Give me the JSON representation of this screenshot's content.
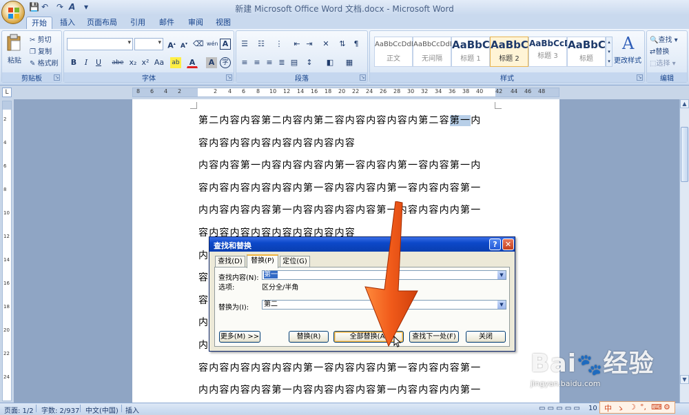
{
  "window": {
    "title": "新建 Microsoft Office Word 文档.docx - Microsoft Word"
  },
  "quick_access": [
    "save-icon",
    "undo-icon",
    "redo-icon",
    "font-color-icon",
    "customize-icon"
  ],
  "tabs": [
    {
      "label": "开始",
      "active": true
    },
    {
      "label": "插入",
      "active": false
    },
    {
      "label": "页面布局",
      "active": false
    },
    {
      "label": "引用",
      "active": false
    },
    {
      "label": "邮件",
      "active": false
    },
    {
      "label": "审阅",
      "active": false
    },
    {
      "label": "视图",
      "active": false
    }
  ],
  "ribbon": {
    "clipboard": {
      "label": "剪贴板",
      "paste": "粘贴",
      "cut": "剪切",
      "copy": "复制",
      "format_painter": "格式刷"
    },
    "font": {
      "label": "字体",
      "font_name": "",
      "font_size": "",
      "bold": "B",
      "italic": "I",
      "underline": "U",
      "strike": "abe",
      "subscript": "x₂",
      "superscript": "x²",
      "change_case": "Aa",
      "grow": "A",
      "shrink": "A",
      "clear": "",
      "phonetic": "wén",
      "border_char": "A",
      "shade_char": "A",
      "circle_char": "字"
    },
    "paragraph": {
      "label": "段落"
    },
    "styles": {
      "label": "样式",
      "items": [
        {
          "sample": "AaBbCcDdEe",
          "name": "正文"
        },
        {
          "sample": "AaBbCcDdEe",
          "name": "无间隔"
        },
        {
          "sample": "AaBbCc",
          "name": "标题 1"
        },
        {
          "sample": "AaBbC",
          "name": "标题 2"
        },
        {
          "sample": "AaBbCcDc",
          "name": "标题 3"
        },
        {
          "sample": "AaBbC",
          "name": "标题"
        }
      ],
      "change_styles": "更改样式"
    },
    "editing": {
      "label": "编辑",
      "find": "查找",
      "replace": "替换",
      "select": "选择"
    }
  },
  "ruler": {
    "h_ticks": [
      "8",
      "6",
      "4",
      "2",
      "2",
      "4",
      "6",
      "8",
      "10",
      "12",
      "14",
      "16",
      "18",
      "20",
      "22",
      "24",
      "26",
      "28",
      "30",
      "32",
      "34",
      "36",
      "38",
      "40",
      "42",
      "44",
      "46",
      "48"
    ],
    "v_ticks": [
      "2",
      "4",
      "6",
      "8",
      "10",
      "12",
      "14",
      "16",
      "18",
      "20",
      "22",
      "24"
    ]
  },
  "document": {
    "lines": [
      {
        "pre": "第二内容内容第二内容内第二容内容内容内容内第二容",
        "hl": "第一",
        "post": "内"
      },
      {
        "pre": "容内容内容内容内容内容内容内容",
        "hl": "",
        "post": ""
      },
      {
        "pre": "内容内容第一内容内容内容内第一容内容内第一容内容第一内",
        "hl": "",
        "post": ""
      },
      {
        "pre": "容内容内容内容内容内第一容内容内容内第一容内容内容第一",
        "hl": "",
        "post": ""
      },
      {
        "pre": "内内容内容内容第一内容内容内容内容第一内容内容内内第一",
        "hl": "",
        "post": ""
      },
      {
        "pre": "容内容内容内容内容内容内容内容",
        "hl": "",
        "post": ""
      },
      {
        "pre": "内",
        "hl": "",
        "post": ""
      },
      {
        "pre": "容",
        "hl": "",
        "post": ""
      },
      {
        "pre": "容",
        "hl": "",
        "post": ""
      },
      {
        "pre": "内",
        "hl": "",
        "post": ""
      },
      {
        "pre": "内",
        "hl": "",
        "post": ""
      },
      {
        "pre": "容内容内容内容内容内第一容内容内容内第一容内容内容第一",
        "hl": "",
        "post": ""
      },
      {
        "pre": "内内容内容内容第一内容内容内容内容第一内容内容内内第一",
        "hl": "",
        "post": ""
      }
    ]
  },
  "dialog": {
    "title": "查找和替换",
    "help": "?",
    "close": "✕",
    "tabs": [
      {
        "label": "查找(D)",
        "active": false
      },
      {
        "label": "替换(P)",
        "active": true
      },
      {
        "label": "定位(G)",
        "active": false
      }
    ],
    "find_label": "查找内容(N):",
    "find_value": "第一",
    "options_label": "选项:",
    "options_value": "区分全/半角",
    "replace_label": "替换为(I):",
    "replace_value": "第二",
    "buttons": {
      "more": "更多(M) >>",
      "replace": "替换(R)",
      "replace_all": "全部替换(A)",
      "find_next": "查找下一处(F)",
      "close": "关闭"
    }
  },
  "statusbar": {
    "page": "页面: 1/2",
    "words": "字数: 2/937",
    "language": "中文(中国)",
    "mode": "插入",
    "zoom": "10"
  },
  "watermark": {
    "brand": "Bai经验",
    "url": "jingyan.baidu.com"
  },
  "ime": {
    "items": [
      "中",
      "ゝ",
      "☽",
      "°,",
      "⌨",
      "⚙"
    ]
  },
  "colors": {
    "arrow": "#f05a1a",
    "highlight": "#b8cfe8",
    "dialog_title": "#0c48c8"
  }
}
